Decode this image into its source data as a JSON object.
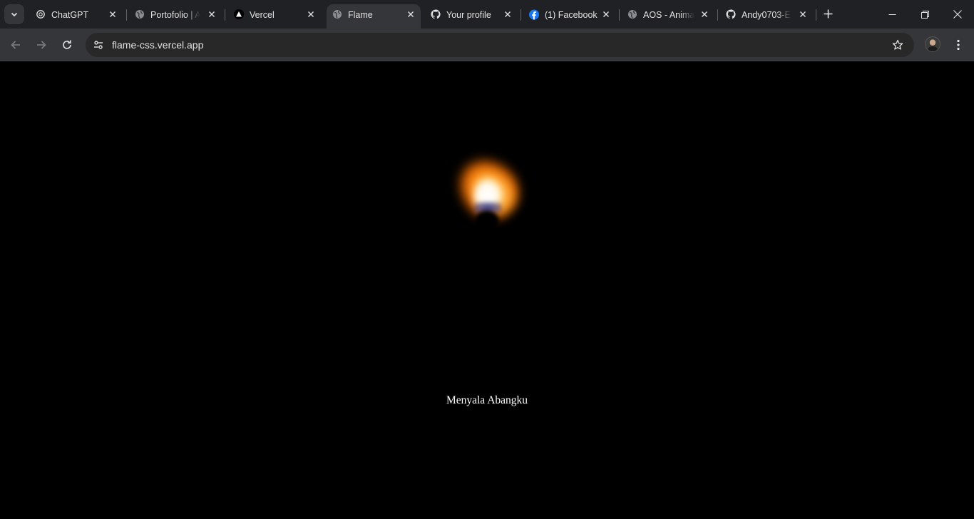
{
  "browser": {
    "tabs": [
      {
        "title": "ChatGPT",
        "icon": "openai-icon",
        "active": false
      },
      {
        "title": "Portofolio | A",
        "icon": "globe-icon",
        "active": false
      },
      {
        "title": "Vercel",
        "icon": "vercel-icon",
        "active": false
      },
      {
        "title": "Flame",
        "icon": "globe-icon",
        "active": true
      },
      {
        "title": "Your profile",
        "icon": "github-icon",
        "active": false
      },
      {
        "title": "(1) Facebook",
        "icon": "facebook-icon",
        "active": false
      },
      {
        "title": "AOS - Anima",
        "icon": "globe-icon",
        "active": false
      },
      {
        "title": "Andy0703-E",
        "icon": "github-icon",
        "active": false
      }
    ],
    "address_bar": {
      "url": "flame-css.vercel.app"
    },
    "colors": {
      "tab_strip": "#202124",
      "toolbar": "#35363a",
      "omnibox": "#282828",
      "facebook": "#1877f2"
    }
  },
  "page": {
    "caption": "Menyala Abangku",
    "background": "#000000",
    "flame_colors": {
      "outer": "#ff9a20",
      "inner": "#ffffff",
      "base": "#3a3a88"
    }
  }
}
